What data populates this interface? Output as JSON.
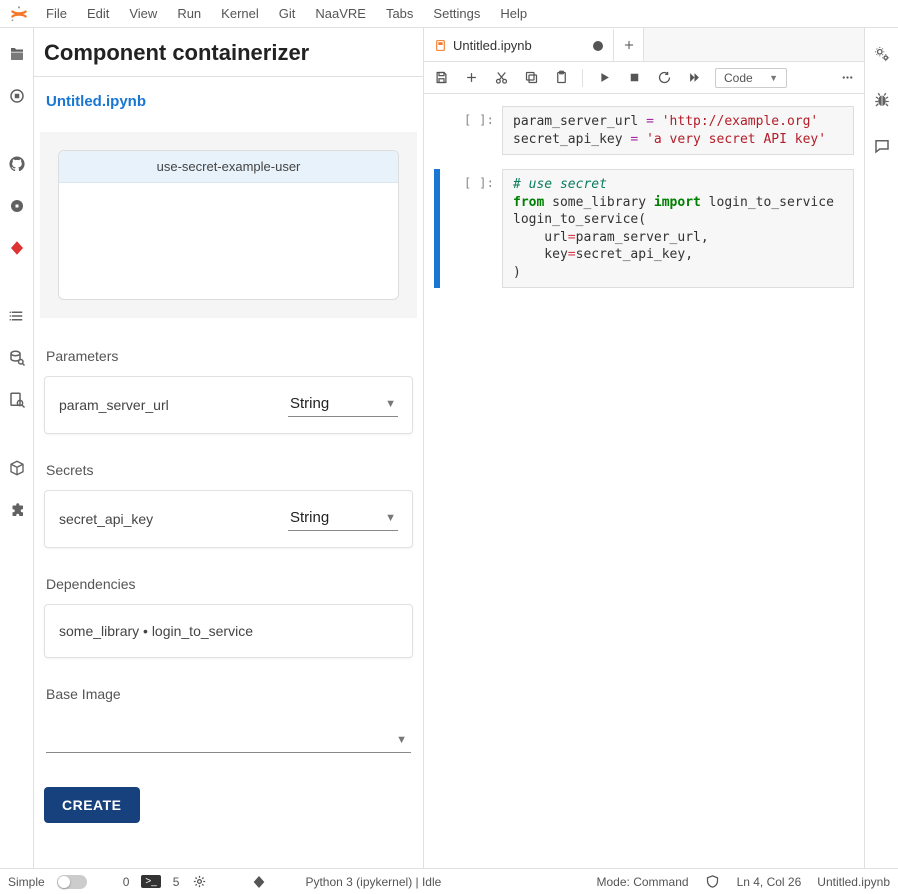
{
  "menu": {
    "items": [
      "File",
      "Edit",
      "View",
      "Run",
      "Kernel",
      "Git",
      "NaaVRE",
      "Tabs",
      "Settings",
      "Help"
    ]
  },
  "activitybar": {
    "icons": [
      "folder-icon",
      "running-icon",
      "git-icon",
      "github-icon",
      "circle-stop-icon",
      "diamond-icon",
      "toc-icon",
      "search-db-icon",
      "search-doc-icon",
      "cube-icon",
      "puzzle-icon"
    ]
  },
  "sidepanel": {
    "title": "Component containerizer",
    "subtitle": "Untitled.ipynb",
    "node_header": "use-secret-example-user",
    "parameters_label": "Parameters",
    "parameters": [
      {
        "name": "param_server_url",
        "type": "String"
      }
    ],
    "secrets_label": "Secrets",
    "secrets": [
      {
        "name": "secret_api_key",
        "type": "String"
      }
    ],
    "dependencies_label": "Dependencies",
    "dependencies_text": "some_library • login_to_service",
    "baseimage_label": "Base Image",
    "baseimage_value": "",
    "create_label": "CREATE"
  },
  "notebook": {
    "tab_label": "Untitled.ipynb",
    "celltype": "Code",
    "cells": [
      {
        "prompt": "[ ]:",
        "tokens": [
          {
            "t": "param_server_url "
          },
          {
            "t": "=",
            "c": "tok-op"
          },
          {
            "t": " "
          },
          {
            "t": "'http://example.org'",
            "c": "tok-str"
          },
          {
            "t": "\n"
          },
          {
            "t": "secret_api_key "
          },
          {
            "t": "=",
            "c": "tok-op"
          },
          {
            "t": " "
          },
          {
            "t": "'a very secret API key'",
            "c": "tok-str"
          }
        ]
      },
      {
        "prompt": "[ ]:",
        "active": true,
        "tokens": [
          {
            "t": "# use secret",
            "c": "tok-cmt"
          },
          {
            "t": "\n"
          },
          {
            "t": "from",
            "c": "tok-kw"
          },
          {
            "t": " some_library "
          },
          {
            "t": "import",
            "c": "tok-kw2"
          },
          {
            "t": " login_to_service\n"
          },
          {
            "t": "login_to_service(\n"
          },
          {
            "t": "    url"
          },
          {
            "t": "=",
            "c": "tok-eq"
          },
          {
            "t": "param_server_url,\n"
          },
          {
            "t": "    key"
          },
          {
            "t": "=",
            "c": "tok-eq"
          },
          {
            "t": "secret_api_key,\n"
          },
          {
            "t": ")"
          }
        ]
      }
    ]
  },
  "rightstrip": {
    "icons": [
      "gears-icon",
      "bug-icon",
      "chat-icon"
    ]
  },
  "statusbar": {
    "simple_label": "Simple",
    "term_count": "0",
    "kernel_count": "5",
    "kernel_text": "Python 3 (ipykernel) | Idle",
    "mode_text": "Mode: Command",
    "lncol_text": "Ln 4, Col 26",
    "file_text": "Untitled.ipynb"
  }
}
